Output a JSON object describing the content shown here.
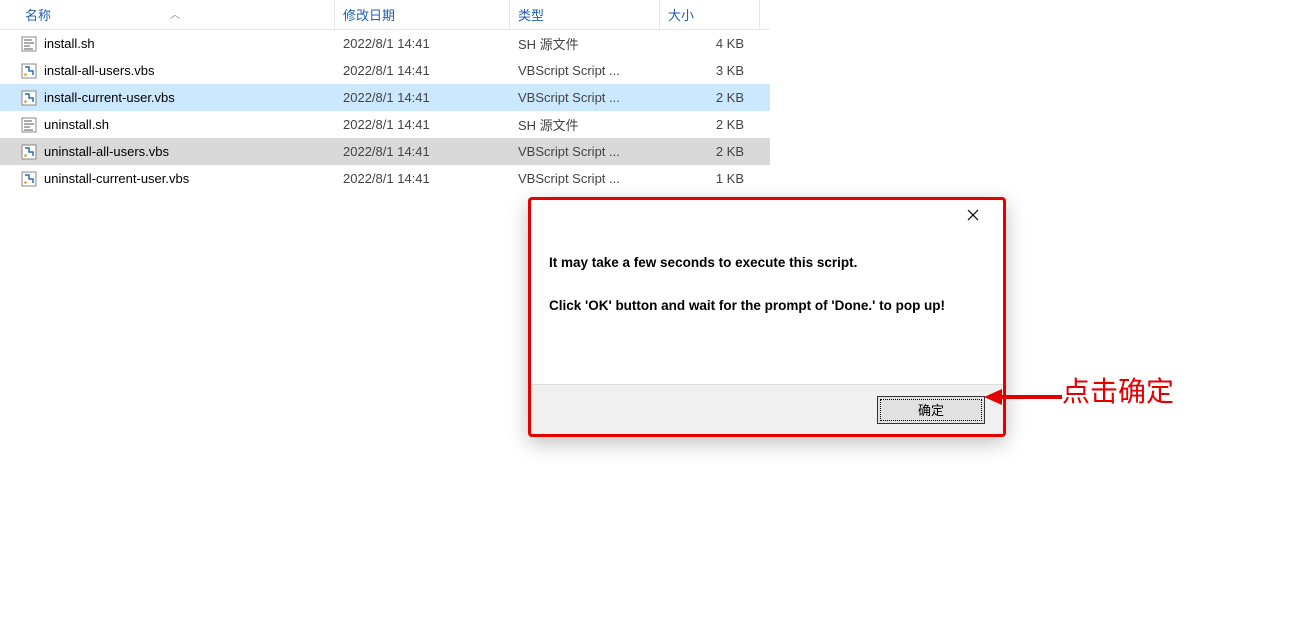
{
  "columns": {
    "name": "名称",
    "date": "修改日期",
    "type": "类型",
    "size": "大小"
  },
  "files": [
    {
      "name": "install.sh",
      "date": "2022/8/1 14:41",
      "type": "SH 源文件",
      "size": "4 KB",
      "icon": "sh",
      "state": ""
    },
    {
      "name": "install-all-users.vbs",
      "date": "2022/8/1 14:41",
      "type": "VBScript Script ...",
      "size": "3 KB",
      "icon": "vbs",
      "state": ""
    },
    {
      "name": "install-current-user.vbs",
      "date": "2022/8/1 14:41",
      "type": "VBScript Script ...",
      "size": "2 KB",
      "icon": "vbs",
      "state": "selected"
    },
    {
      "name": "uninstall.sh",
      "date": "2022/8/1 14:41",
      "type": "SH 源文件",
      "size": "2 KB",
      "icon": "sh",
      "state": ""
    },
    {
      "name": "uninstall-all-users.vbs",
      "date": "2022/8/1 14:41",
      "type": "VBScript Script ...",
      "size": "2 KB",
      "icon": "vbs",
      "state": "highlighted"
    },
    {
      "name": "uninstall-current-user.vbs",
      "date": "2022/8/1 14:41",
      "type": "VBScript Script ...",
      "size": "1 KB",
      "icon": "vbs",
      "state": ""
    }
  ],
  "dialog": {
    "line1": "It may take a few seconds to execute this script.",
    "line2": "Click 'OK' button and wait for the prompt of 'Done.' to pop up!",
    "ok": "确定"
  },
  "annotation": "点击确定"
}
